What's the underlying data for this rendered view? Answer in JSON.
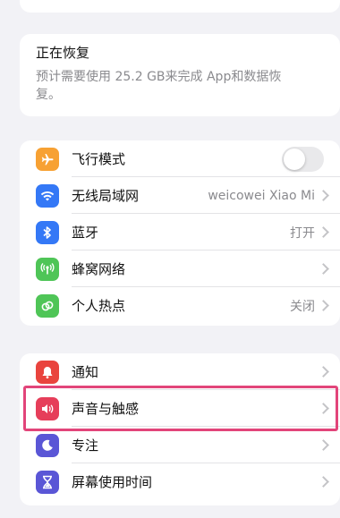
{
  "restore": {
    "title": "正在恢复",
    "description": "预计需要使用 25.2 GB来完成 App和数据恢复。"
  },
  "network_group": [
    {
      "id": "airplane",
      "label": "飞行模式",
      "value": "",
      "icon": "airplane-icon",
      "color": "#f7a133",
      "control": "toggle",
      "toggle_on": false
    },
    {
      "id": "wifi",
      "label": "无线局域网",
      "value": "weicowei Xiao Mi",
      "icon": "wifi-icon",
      "color": "#3478f6",
      "control": "chevron"
    },
    {
      "id": "bluetooth",
      "label": "蓝牙",
      "value": "打开",
      "icon": "bluetooth-icon",
      "color": "#3478f6",
      "control": "chevron"
    },
    {
      "id": "cellular",
      "label": "蜂窝网络",
      "value": "",
      "icon": "cellular-icon",
      "color": "#4fc557",
      "control": "chevron"
    },
    {
      "id": "hotspot",
      "label": "个人热点",
      "value": "关闭",
      "icon": "hotspot-icon",
      "color": "#4fc557",
      "control": "chevron"
    }
  ],
  "system_group": [
    {
      "id": "notifications",
      "label": "通知",
      "icon": "bell-icon",
      "color": "#e9443e"
    },
    {
      "id": "sounds",
      "label": "声音与触感",
      "icon": "speaker-icon",
      "color": "#e63e5a",
      "highlighted": true
    },
    {
      "id": "focus",
      "label": "专注",
      "icon": "moon-icon",
      "color": "#5a56d6"
    },
    {
      "id": "screen-time",
      "label": "屏幕使用时间",
      "icon": "hourglass-icon",
      "color": "#5a56d6"
    }
  ]
}
